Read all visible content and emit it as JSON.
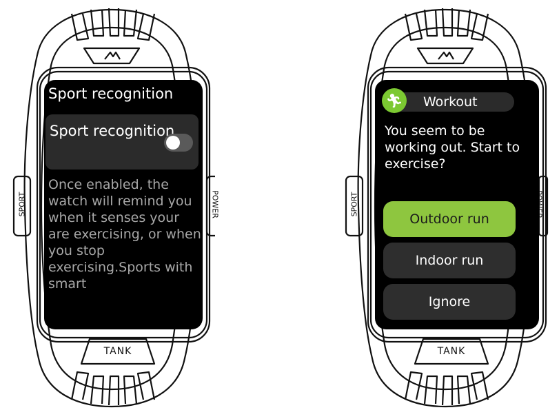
{
  "brand": {
    "logo_text": "TANK",
    "left_button": "SPORT",
    "right_button": "POWER"
  },
  "colors": {
    "screen_bg": "#000000",
    "accent_green": "#8ec63f",
    "row_bg": "#2b2b2b"
  },
  "watch_left": {
    "title": "Sport recognition",
    "setting_row": {
      "label": "Sport recognition",
      "toggle_state": "off"
    },
    "description": "Once enabled, the watch will remind you when it senses your are exercising, or when you stop exercising.Sports with smart"
  },
  "watch_right": {
    "header": {
      "icon": "running-person-icon",
      "label": "Workout"
    },
    "prompt": "You seem to be working out. Start to exercise?",
    "buttons": [
      {
        "label": "Outdoor run"
      },
      {
        "label": "Indoor run"
      },
      {
        "label": "Ignore"
      }
    ]
  }
}
